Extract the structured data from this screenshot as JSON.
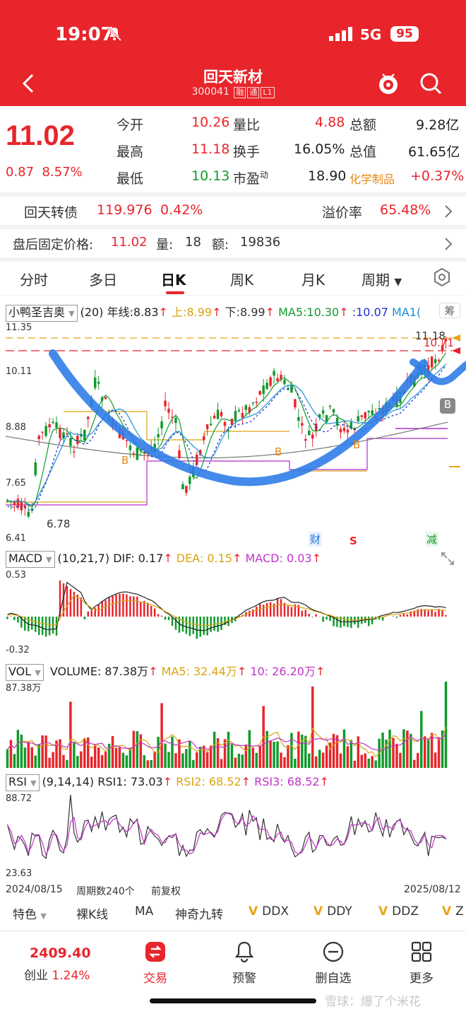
{
  "status": {
    "time": "19:07",
    "network": "5G",
    "battery": "95"
  },
  "header": {
    "name": "回天新材",
    "code": "300041",
    "tags": [
      "融",
      "通",
      "L1"
    ]
  },
  "quote": {
    "price": "11.02",
    "change": "0.87",
    "change_pct": "8.57%",
    "rows": [
      {
        "l1": "今开",
        "v1": "10.26",
        "l2": "量比",
        "v2": "4.88",
        "l3": "总额",
        "v3": "9.28亿"
      },
      {
        "l1": "最高",
        "v1": "11.18",
        "l2": "换手",
        "v2": "16.05%",
        "l3": "总值",
        "v3": "61.65亿"
      },
      {
        "l1": "最低",
        "v1": "10.13",
        "l2": "市盈",
        "l2sup": "动",
        "v2": "18.90",
        "l3": "化学制品",
        "v3": "+0.37%"
      }
    ]
  },
  "bond": {
    "name": "回天转债",
    "price": "119.976",
    "pct": "0.42%",
    "premium_label": "溢价率",
    "premium": "65.48%"
  },
  "after_hours": {
    "label": "盘后固定价格:",
    "price": "11.02",
    "vol_label": "量:",
    "vol": "18",
    "amt_label": "额:",
    "amt": "19836"
  },
  "tabs": [
    "分时",
    "多日",
    "日K",
    "周K",
    "月K",
    "周期"
  ],
  "kline": {
    "indicator_name": "小鸭圣吉奥",
    "indicator_param": "(20)",
    "year_line": "年线:8.83",
    "upper": "上:8.99",
    "lower": "下:8.99",
    "ma5": "MA5:10.30",
    "ma_extra": ":10.07",
    "ma10": "MA1(",
    "right_btn": "筹",
    "y_labels": [
      "11.35",
      "10.11",
      "8.88",
      "7.65",
      "6.41"
    ],
    "high_label": "11.18",
    "close_label": "10.71",
    "low_label": "6.78",
    "markers": {
      "b": "B",
      "s": "S",
      "cai": "财",
      "jian": "减",
      "b_box": "B"
    }
  },
  "macd": {
    "name": "MACD",
    "param": "(10,21,7)",
    "dif": "DIF: 0.17",
    "dea": "DEA: 0.15",
    "macd": "MACD: 0.03",
    "y_top": "0.53",
    "y_bottom": "-0.32"
  },
  "vol": {
    "name": "VOL",
    "volume": "VOLUME: 87.38万",
    "ma5": "MA5: 32.44万",
    "ma10": "10: 26.20万",
    "y_top": "87.38万"
  },
  "rsi": {
    "name": "RSI",
    "param": "(9,14,14)",
    "rsi1": "RSI1: 73.03",
    "rsi2": "RSI2: 68.52",
    "rsi3": "RSI3: 68.52",
    "y_top": "88.72",
    "y_bottom": "23.63"
  },
  "footer_axis": {
    "start": "2024/08/15",
    "count": "周期数240个",
    "adj": "前复权",
    "end": "2025/08/12"
  },
  "tools": {
    "color": "特色",
    "items": [
      "裸K线",
      "MA",
      "神奇九转"
    ],
    "v_items": [
      "DDX",
      "DDY",
      "DDZ",
      "Z"
    ]
  },
  "nav": {
    "index_value": "2409.40",
    "index_name": "创业",
    "index_pct": "1.24%",
    "items": [
      "交易",
      "预警",
      "删自选",
      "更多"
    ]
  },
  "watermark": "雪球：爆了个米花",
  "colors": {
    "up": "#e8252b",
    "down": "#119a2c",
    "accent": "#e8252b"
  }
}
